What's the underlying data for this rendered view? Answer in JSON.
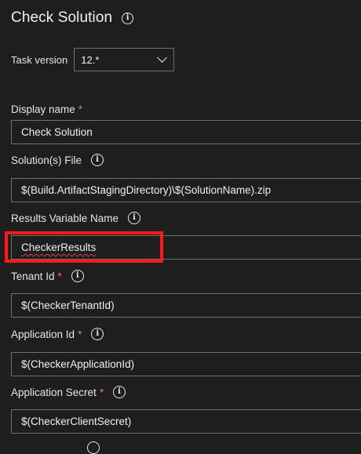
{
  "header": {
    "title": "Check Solution"
  },
  "task_version": {
    "label": "Task version",
    "selected": "12.*"
  },
  "fields": [
    {
      "label": "Display name",
      "required": "*",
      "value": "Check Solution"
    },
    {
      "label": "Solution(s) File",
      "value": "$(Build.ArtifactStagingDirectory)\\$(SolutionName).zip"
    },
    {
      "label": "Results Variable Name",
      "value": "CheckerResults"
    },
    {
      "label": "Tenant Id",
      "required": "*",
      "value": "$(CheckerTenantId)"
    },
    {
      "label": "Application Id",
      "required": "*",
      "value": "$(CheckerApplicationId)"
    },
    {
      "label": "Application Secret",
      "required": "*",
      "value": "$(CheckerClientSecret)"
    }
  ],
  "icons": {
    "info": "i"
  },
  "colors": {
    "background": "#1e1e1e",
    "required": "#f1707b",
    "highlight": "#ff1a1a"
  }
}
